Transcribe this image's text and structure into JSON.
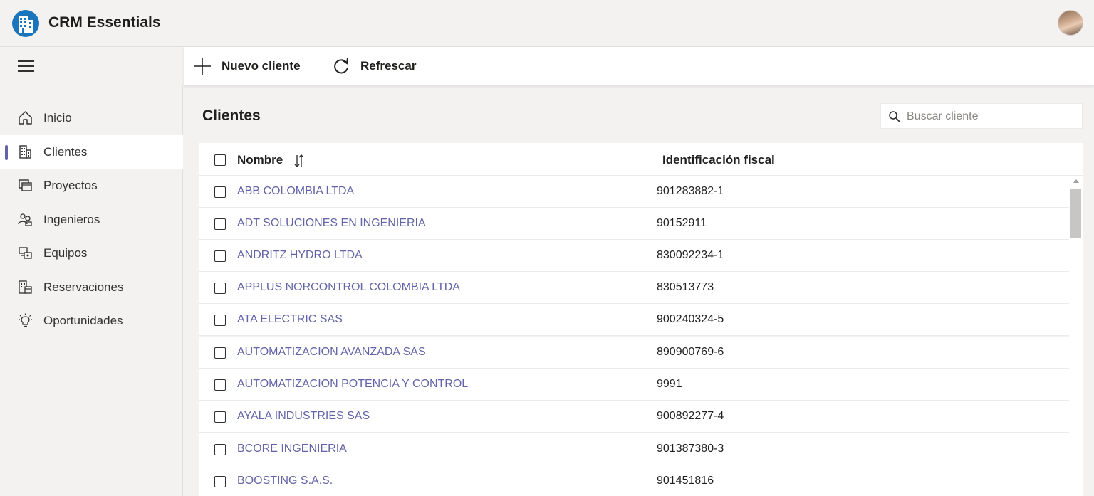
{
  "app": {
    "title": "CRM Essentials"
  },
  "user": {
    "avatar_label": ""
  },
  "commandbar": {
    "new_label": "Nuevo cliente",
    "refresh_label": "Refrescar"
  },
  "sidebar": {
    "items": [
      {
        "label": "Inicio",
        "icon": "home-icon",
        "active": false
      },
      {
        "label": "Clientes",
        "icon": "building-icon",
        "active": true
      },
      {
        "label": "Proyectos",
        "icon": "folders-icon",
        "active": false
      },
      {
        "label": "Ingenieros",
        "icon": "people-icon",
        "active": false
      },
      {
        "label": "Equipos",
        "icon": "devices-icon",
        "active": false
      },
      {
        "label": "Reservaciones",
        "icon": "calendar-building-icon",
        "active": false
      },
      {
        "label": "Oportunidades",
        "icon": "lightbulb-icon",
        "active": false
      }
    ]
  },
  "page": {
    "title": "Clientes",
    "search_placeholder": "Buscar cliente"
  },
  "table": {
    "columns": {
      "name": "Nombre",
      "tax_id": "Identificación fiscal"
    },
    "rows": [
      {
        "name": "ABB COLOMBIA LTDA",
        "tax_id": "901283882-1"
      },
      {
        "name": "ADT SOLUCIONES EN INGENIERIA",
        "tax_id": "90152911"
      },
      {
        "name": "ANDRITZ HYDRO LTDA",
        "tax_id": "830092234-1"
      },
      {
        "name": "APPLUS NORCONTROL COLOMBIA LTDA",
        "tax_id": "830513773"
      },
      {
        "name": "ATA ELECTRIC SAS",
        "tax_id": "900240324-5"
      },
      {
        "name": "AUTOMATIZACION AVANZADA SAS",
        "tax_id": "890900769-6"
      },
      {
        "name": "AUTOMATIZACION POTENCIA Y CONTROL",
        "tax_id": "9991"
      },
      {
        "name": "AYALA INDUSTRIES SAS",
        "tax_id": "900892277-4"
      },
      {
        "name": "BCORE INGENIERIA",
        "tax_id": "901387380-3"
      },
      {
        "name": "BOOSTING S.A.S.",
        "tax_id": "901451816"
      }
    ]
  },
  "colors": {
    "accent": "#6264a7",
    "background": "#f3f2f1",
    "surface": "#ffffff",
    "logo_blue": "#0f6cbd"
  }
}
